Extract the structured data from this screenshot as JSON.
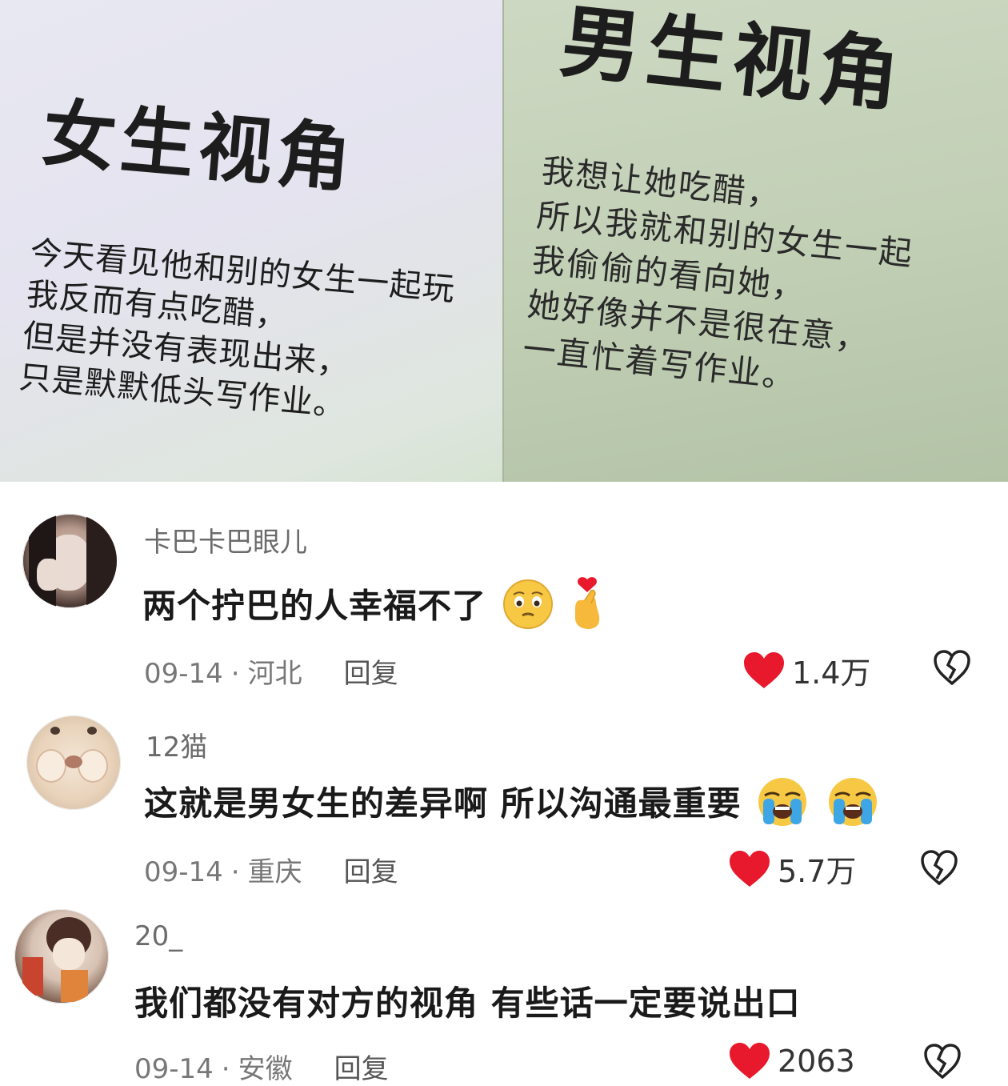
{
  "photo": {
    "left": {
      "heading": "女生视角",
      "lines": [
        "今天看见他和别的女生一起玩",
        "我反而有点吃醋，",
        "但是并没有表现出来，",
        "只是默默低头写作业。"
      ]
    },
    "right": {
      "heading": "男生视角",
      "lines": [
        "我想让她吃醋，",
        "所以我就和别的女生一起",
        "我偷偷的看向她，",
        "她好像并不是很在意，",
        "一直忙着写作业。"
      ]
    }
  },
  "comments": [
    {
      "username": "卡巴卡巴眼儿",
      "text": "两个拧巴的人幸福不了",
      "emojis": [
        "pleading-face-icon",
        "finger-heart-icon"
      ],
      "date": "09-14",
      "location": "河北",
      "reply_label": "回复",
      "likes": "1.4万"
    },
    {
      "username": "12猫",
      "text": "这就是男女生的差异啊 所以沟通最重要",
      "emojis": [
        "loudly-crying-face-icon",
        "loudly-crying-face-icon"
      ],
      "date": "09-14",
      "location": "重庆",
      "reply_label": "回复",
      "likes": "5.7万"
    },
    {
      "username": "20_",
      "text": "我们都没有对方的视角 有些话一定要说出口",
      "emojis": [],
      "date": "09-14",
      "location": "安徽",
      "reply_label": "回复",
      "likes": "2063"
    }
  ],
  "colors": {
    "like_heart": "#e8192c",
    "meta_text": "#777777",
    "username_text": "#6b6b6b"
  }
}
